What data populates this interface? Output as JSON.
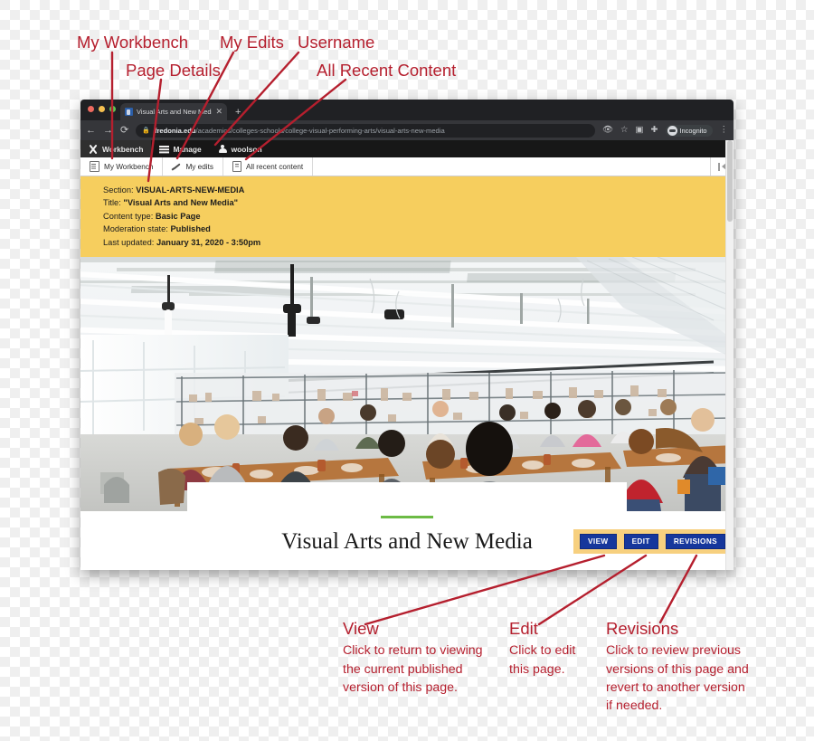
{
  "annotations": {
    "top": [
      {
        "id": "my-workbench",
        "label": "My Workbench"
      },
      {
        "id": "page-details",
        "label": "Page Details"
      },
      {
        "id": "my-edits",
        "label": "My Edits"
      },
      {
        "id": "username",
        "label": "Username"
      },
      {
        "id": "all-recent-content",
        "label": "All Recent Content"
      }
    ],
    "bottom": [
      {
        "id": "view",
        "title": "View",
        "body": "Click to return to viewing the current published version of this page."
      },
      {
        "id": "edit",
        "title": "Edit",
        "body": "Click to edit this page."
      },
      {
        "id": "revisions",
        "title": "Revisions",
        "body": "Click to review previous versions of this page and revert to another version if needed."
      }
    ],
    "color": "#b51f2e"
  },
  "browser": {
    "tab": {
      "title": "Visual Arts and New Media | Fre",
      "close_icon": "close-icon",
      "new_tab_icon": "plus-icon"
    },
    "window_controls": [
      "close",
      "minimize",
      "zoom"
    ],
    "nav": {
      "back": "←",
      "forward": "→",
      "reload": "⟳"
    },
    "omnibox": {
      "lock_icon": "lock-icon",
      "domain": "fredonia.edu",
      "path": "/academics/colleges-schools/college-visual-performing-arts/visual-arts-new-media"
    },
    "toolbar_right": {
      "extensions_blocked_icon": "eye-slash-icon",
      "bookmark_icon": "star-icon",
      "camera_icon": "camera-icon",
      "puzzle_icon": "extensions-icon",
      "profile_label": "Incognito",
      "menu_icon": "kebab-menu-icon"
    }
  },
  "admin_bar": {
    "items": [
      {
        "id": "workbench",
        "label": "Workbench",
        "icon": "workbench-icon",
        "active": true
      },
      {
        "id": "manage",
        "label": "Manage",
        "icon": "hamburger-icon",
        "active": false
      },
      {
        "id": "user",
        "label": "woolson",
        "icon": "user-icon",
        "active": false
      }
    ]
  },
  "workbench_tabs": {
    "items": [
      {
        "id": "my-workbench",
        "label": "My Workbench",
        "icon": "list-icon"
      },
      {
        "id": "my-edits",
        "label": "My edits",
        "icon": "pencil-icon"
      },
      {
        "id": "all-recent-content",
        "label": "All recent content",
        "icon": "page-icon"
      }
    ],
    "orientation_toggle_icon": "orientation-toggle-icon"
  },
  "details_panel": {
    "background": "#f6ce5e",
    "rows": [
      {
        "label": "Section:",
        "value": "VISUAL-ARTS-NEW-MEDIA"
      },
      {
        "label": "Title:",
        "value": "\"Visual Arts and New Media\""
      },
      {
        "label": "Content type:",
        "value": "Basic Page"
      },
      {
        "label": "Moderation state:",
        "value": "Published"
      },
      {
        "label": "Last updated:",
        "value": "January 31, 2020 - 3:50pm"
      }
    ]
  },
  "page": {
    "hero_alt": "Students working at tables in a bright art studio",
    "title": "Visual Arts and New Media",
    "accent_rule_color": "#6cbb45",
    "actions": [
      {
        "id": "view",
        "label": "VIEW"
      },
      {
        "id": "edit",
        "label": "EDIT"
      },
      {
        "id": "revisions",
        "label": "REVISIONS"
      }
    ],
    "action_bar_background": "#f7d07f",
    "action_button_color": "#16379c"
  }
}
